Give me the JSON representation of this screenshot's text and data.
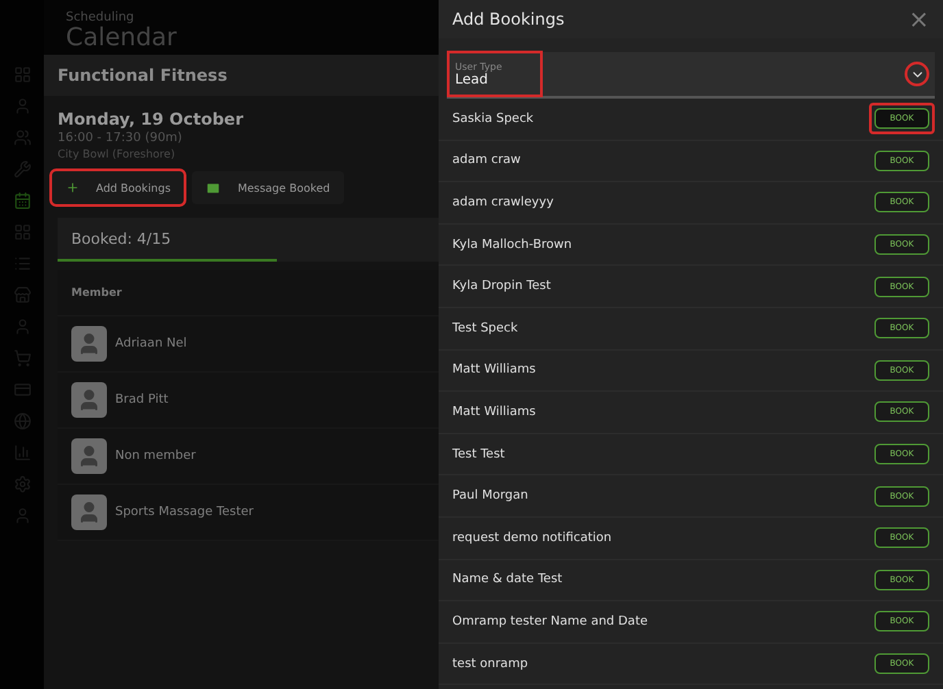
{
  "page_header": {
    "section": "Scheduling",
    "title": "Calendar"
  },
  "sidebar": {
    "items": [
      {
        "kind": "grid",
        "selected": false
      },
      {
        "kind": "user",
        "selected": false
      },
      {
        "kind": "users",
        "selected": false
      },
      {
        "kind": "tool",
        "selected": false
      },
      {
        "kind": "calendar",
        "selected": true
      },
      {
        "kind": "grid",
        "selected": false
      },
      {
        "kind": "list",
        "selected": false
      },
      {
        "kind": "store",
        "selected": false
      },
      {
        "kind": "user",
        "selected": false
      },
      {
        "kind": "cart",
        "selected": false
      },
      {
        "kind": "card",
        "selected": false
      },
      {
        "kind": "globe",
        "selected": false
      },
      {
        "kind": "chart",
        "selected": false
      },
      {
        "kind": "settings",
        "selected": false
      },
      {
        "kind": "user",
        "selected": false
      }
    ]
  },
  "class_panel": {
    "title": "Functional Fitness",
    "date": "Monday, 19 October",
    "time": "16:00 - 17:30 (90m)",
    "location": "City Bowl (Foreshore)",
    "actions": [
      {
        "kind": "add",
        "label": "Add Bookings",
        "highlighted": true
      },
      {
        "kind": "message",
        "label": "Message Booked",
        "highlighted": false
      }
    ],
    "booked_tab": "Booked: 4/15",
    "column": "Member",
    "members": [
      "Adriaan Nel",
      "Brad Pitt",
      "Non member",
      "Sports Massage Tester"
    ]
  },
  "drawer": {
    "title": "Add Bookings",
    "close": "×",
    "user_type": {
      "label": "User Type",
      "value": "Lead",
      "highlighted": true,
      "chevron_highlighted": true
    },
    "people": [
      {
        "name": "Saskia Speck",
        "button": "BOOK",
        "highlighted": true
      },
      {
        "name": "adam craw",
        "button": "BOOK",
        "highlighted": false
      },
      {
        "name": "adam crawleyyy",
        "button": "BOOK",
        "highlighted": false
      },
      {
        "name": "Kyla Malloch-Brown",
        "button": "BOOK",
        "highlighted": false
      },
      {
        "name": "Kyla Dropin Test",
        "button": "BOOK",
        "highlighted": false
      },
      {
        "name": "Test Speck",
        "button": "BOOK",
        "highlighted": false
      },
      {
        "name": "Matt Williams",
        "button": "BOOK",
        "highlighted": false
      },
      {
        "name": "Matt Williams",
        "button": "BOOK",
        "highlighted": false
      },
      {
        "name": "Test Test",
        "button": "BOOK",
        "highlighted": false
      },
      {
        "name": "Paul Morgan",
        "button": "BOOK",
        "highlighted": false
      },
      {
        "name": "request demo notification",
        "button": "BOOK",
        "highlighted": false
      },
      {
        "name": "Name & date Test",
        "button": "BOOK",
        "highlighted": false
      },
      {
        "name": "Omramp tester Name and Date",
        "button": "BOOK",
        "highlighted": false
      },
      {
        "name": "test onramp",
        "button": "BOOK",
        "highlighted": false
      }
    ]
  }
}
